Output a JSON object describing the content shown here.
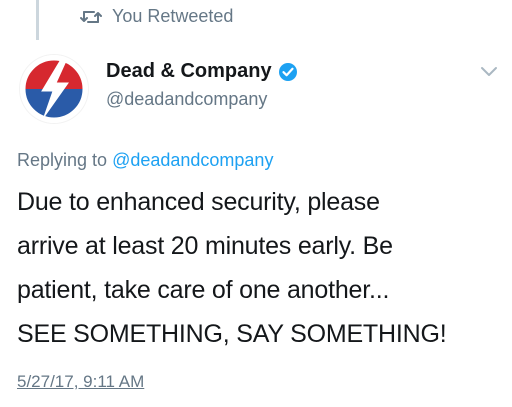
{
  "retweet": {
    "icon": "retweet-icon",
    "label": "You Retweeted"
  },
  "author": {
    "avatar": "steal-your-face-bolt-avatar",
    "name": "Dead & Company",
    "verified_icon": "verified-badge-icon",
    "handle": "@deadandcompany"
  },
  "menu": {
    "icon": "chevron-down-icon"
  },
  "reply": {
    "prefix": "Replying to ",
    "handle": "@deadandcompany"
  },
  "tweet": {
    "lines": [
      "Due to enhanced security, please",
      "arrive at least 20 minutes early. Be",
      "patient, take care of one another...",
      "SEE SOMETHING, SAY SOMETHING!"
    ]
  },
  "timestamp": "5/27/17, 9:11 AM",
  "colors": {
    "link": "#1da1f2",
    "secondary_text": "#657786",
    "verified": "#1da1f2",
    "avatar_red": "#d6282f",
    "avatar_blue": "#2a5ba8"
  }
}
